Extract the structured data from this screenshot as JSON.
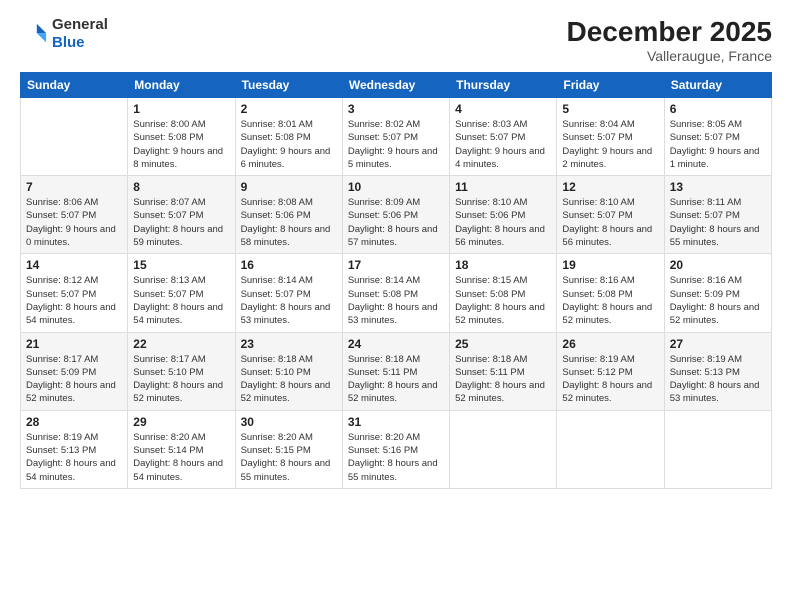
{
  "header": {
    "logo": {
      "line1": "General",
      "line2": "Blue"
    },
    "title": "December 2025",
    "subtitle": "Valleraugue, France"
  },
  "calendar": {
    "weekdays": [
      "Sunday",
      "Monday",
      "Tuesday",
      "Wednesday",
      "Thursday",
      "Friday",
      "Saturday"
    ],
    "weeks": [
      [
        {
          "day": "",
          "info": ""
        },
        {
          "day": "1",
          "info": "Sunrise: 8:00 AM\nSunset: 5:08 PM\nDaylight: 9 hours\nand 8 minutes."
        },
        {
          "day": "2",
          "info": "Sunrise: 8:01 AM\nSunset: 5:08 PM\nDaylight: 9 hours\nand 6 minutes."
        },
        {
          "day": "3",
          "info": "Sunrise: 8:02 AM\nSunset: 5:07 PM\nDaylight: 9 hours\nand 5 minutes."
        },
        {
          "day": "4",
          "info": "Sunrise: 8:03 AM\nSunset: 5:07 PM\nDaylight: 9 hours\nand 4 minutes."
        },
        {
          "day": "5",
          "info": "Sunrise: 8:04 AM\nSunset: 5:07 PM\nDaylight: 9 hours\nand 2 minutes."
        },
        {
          "day": "6",
          "info": "Sunrise: 8:05 AM\nSunset: 5:07 PM\nDaylight: 9 hours\nand 1 minute."
        }
      ],
      [
        {
          "day": "7",
          "info": "Sunrise: 8:06 AM\nSunset: 5:07 PM\nDaylight: 9 hours\nand 0 minutes."
        },
        {
          "day": "8",
          "info": "Sunrise: 8:07 AM\nSunset: 5:07 PM\nDaylight: 8 hours\nand 59 minutes."
        },
        {
          "day": "9",
          "info": "Sunrise: 8:08 AM\nSunset: 5:06 PM\nDaylight: 8 hours\nand 58 minutes."
        },
        {
          "day": "10",
          "info": "Sunrise: 8:09 AM\nSunset: 5:06 PM\nDaylight: 8 hours\nand 57 minutes."
        },
        {
          "day": "11",
          "info": "Sunrise: 8:10 AM\nSunset: 5:06 PM\nDaylight: 8 hours\nand 56 minutes."
        },
        {
          "day": "12",
          "info": "Sunrise: 8:10 AM\nSunset: 5:07 PM\nDaylight: 8 hours\nand 56 minutes."
        },
        {
          "day": "13",
          "info": "Sunrise: 8:11 AM\nSunset: 5:07 PM\nDaylight: 8 hours\nand 55 minutes."
        }
      ],
      [
        {
          "day": "14",
          "info": "Sunrise: 8:12 AM\nSunset: 5:07 PM\nDaylight: 8 hours\nand 54 minutes."
        },
        {
          "day": "15",
          "info": "Sunrise: 8:13 AM\nSunset: 5:07 PM\nDaylight: 8 hours\nand 54 minutes."
        },
        {
          "day": "16",
          "info": "Sunrise: 8:14 AM\nSunset: 5:07 PM\nDaylight: 8 hours\nand 53 minutes."
        },
        {
          "day": "17",
          "info": "Sunrise: 8:14 AM\nSunset: 5:08 PM\nDaylight: 8 hours\nand 53 minutes."
        },
        {
          "day": "18",
          "info": "Sunrise: 8:15 AM\nSunset: 5:08 PM\nDaylight: 8 hours\nand 52 minutes."
        },
        {
          "day": "19",
          "info": "Sunrise: 8:16 AM\nSunset: 5:08 PM\nDaylight: 8 hours\nand 52 minutes."
        },
        {
          "day": "20",
          "info": "Sunrise: 8:16 AM\nSunset: 5:09 PM\nDaylight: 8 hours\nand 52 minutes."
        }
      ],
      [
        {
          "day": "21",
          "info": "Sunrise: 8:17 AM\nSunset: 5:09 PM\nDaylight: 8 hours\nand 52 minutes."
        },
        {
          "day": "22",
          "info": "Sunrise: 8:17 AM\nSunset: 5:10 PM\nDaylight: 8 hours\nand 52 minutes."
        },
        {
          "day": "23",
          "info": "Sunrise: 8:18 AM\nSunset: 5:10 PM\nDaylight: 8 hours\nand 52 minutes."
        },
        {
          "day": "24",
          "info": "Sunrise: 8:18 AM\nSunset: 5:11 PM\nDaylight: 8 hours\nand 52 minutes."
        },
        {
          "day": "25",
          "info": "Sunrise: 8:18 AM\nSunset: 5:11 PM\nDaylight: 8 hours\nand 52 minutes."
        },
        {
          "day": "26",
          "info": "Sunrise: 8:19 AM\nSunset: 5:12 PM\nDaylight: 8 hours\nand 52 minutes."
        },
        {
          "day": "27",
          "info": "Sunrise: 8:19 AM\nSunset: 5:13 PM\nDaylight: 8 hours\nand 53 minutes."
        }
      ],
      [
        {
          "day": "28",
          "info": "Sunrise: 8:19 AM\nSunset: 5:13 PM\nDaylight: 8 hours\nand 54 minutes."
        },
        {
          "day": "29",
          "info": "Sunrise: 8:20 AM\nSunset: 5:14 PM\nDaylight: 8 hours\nand 54 minutes."
        },
        {
          "day": "30",
          "info": "Sunrise: 8:20 AM\nSunset: 5:15 PM\nDaylight: 8 hours\nand 55 minutes."
        },
        {
          "day": "31",
          "info": "Sunrise: 8:20 AM\nSunset: 5:16 PM\nDaylight: 8 hours\nand 55 minutes."
        },
        {
          "day": "",
          "info": ""
        },
        {
          "day": "",
          "info": ""
        },
        {
          "day": "",
          "info": ""
        }
      ]
    ]
  }
}
